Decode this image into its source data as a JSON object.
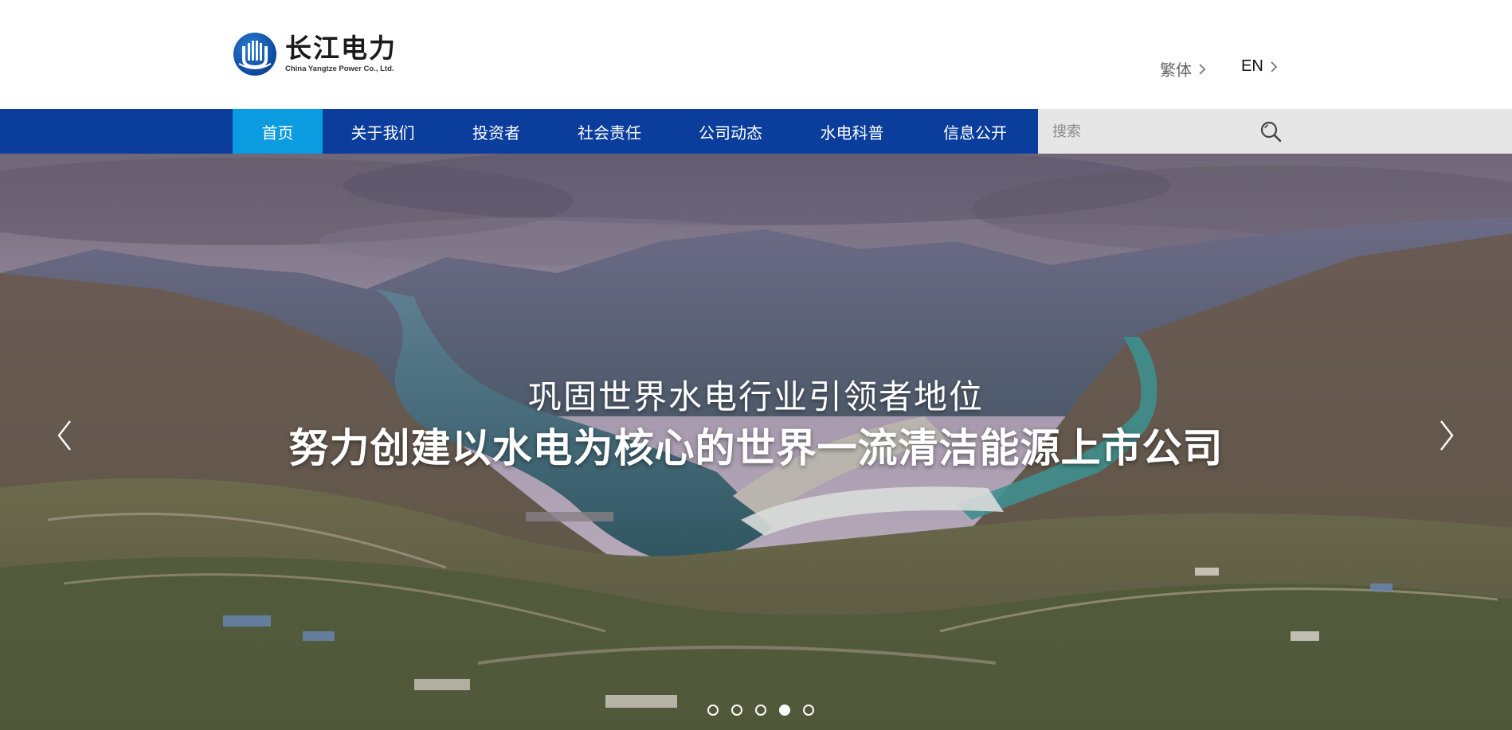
{
  "header": {
    "logo_cn": "长江电力",
    "logo_en": "China Yangtze Power Co., Ltd.",
    "lang_traditional": "繁体",
    "lang_english": "EN"
  },
  "nav": {
    "items": [
      {
        "label": "首页",
        "active": true
      },
      {
        "label": "关于我们"
      },
      {
        "label": "投资者"
      },
      {
        "label": "社会责任"
      },
      {
        "label": "公司动态"
      },
      {
        "label": "水电科普"
      },
      {
        "label": "信息公开"
      }
    ],
    "search_placeholder": "搜索"
  },
  "banner": {
    "slogan_line1": "巩固世界水电行业引领者地位",
    "slogan_line2": "努力创建以水电为核心的世界一流清洁能源上市公司",
    "slide_count": 5,
    "active_slide": 4
  },
  "colors": {
    "nav_background": "#0b3d9c",
    "nav_active": "#0a9be0",
    "search_background": "#e6e6e6"
  }
}
